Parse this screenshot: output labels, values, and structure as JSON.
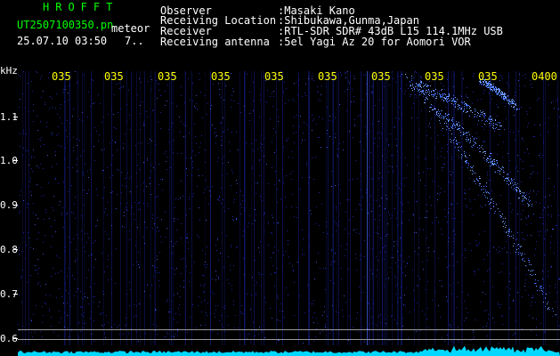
{
  "header": {
    "brand": "HROFFT",
    "filename": "UT2507100350.pn",
    "mode": "meteor",
    "datetime": "25.07.10 03:50",
    "count": "7..",
    "info": [
      {
        "label": "Observer",
        "value": ":Masaki Kano"
      },
      {
        "label": "Receiving Location",
        "value": ":Shibukawa,Gunma,Japan"
      },
      {
        "label": "Receiver",
        "value": ":RTL-SDR SDR# 43dB L15 114.1MHz USB"
      },
      {
        "label": "Receiving antenna",
        "value": ":5el Yagi Az 20 for Aomori VOR"
      }
    ]
  },
  "axis": {
    "y_unit": "kHz",
    "y_ticks": [
      "1.1",
      "1.0",
      "0.9",
      "0.8",
      "0.7",
      "0.6"
    ],
    "time_ticks": [
      "035",
      "035",
      "035",
      "035",
      "035",
      "035",
      "035",
      "035",
      "035",
      "0400"
    ]
  },
  "colors": {
    "background": "#000000",
    "noise": "#1a24a8",
    "signal": "#7aa8ff",
    "baseline": "#00d8ff",
    "header_brand": "#00ff00",
    "axis_ticks": "#ffff00"
  },
  "chart_data": {
    "type": "heatmap",
    "ylabel": "kHz",
    "y_ticks": [
      1.1,
      1.0,
      0.9,
      0.8,
      0.7,
      0.6
    ],
    "x_ticks": [
      "035",
      "035",
      "035",
      "035",
      "035",
      "035",
      "035",
      "035",
      "035",
      "0400"
    ]
  }
}
